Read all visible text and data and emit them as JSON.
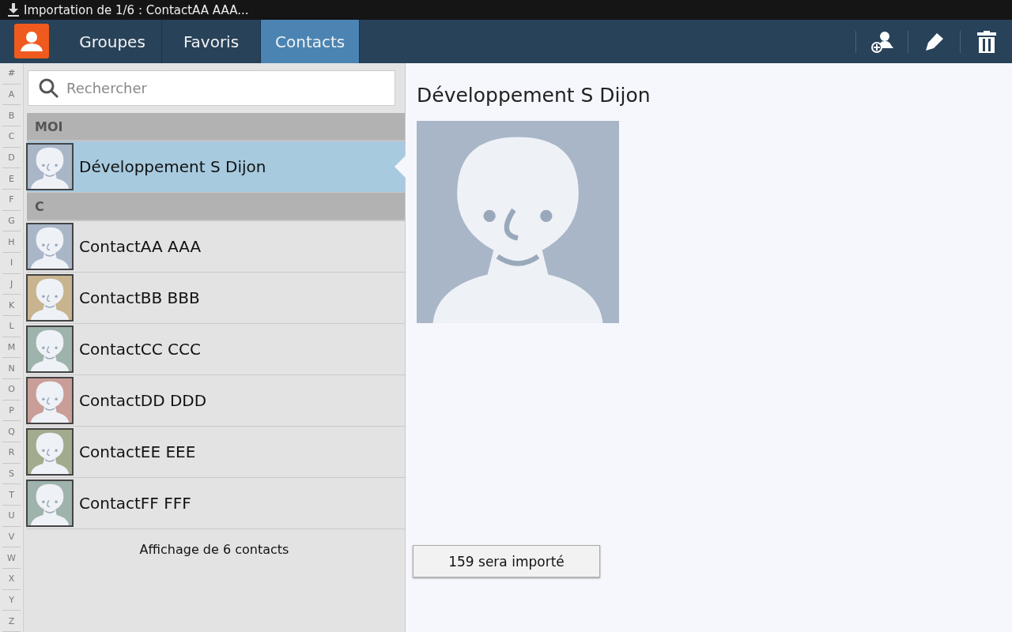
{
  "status_bar": {
    "notification": "Importation de 1/6 : ContactAA AAA..."
  },
  "tabs": [
    {
      "label": "Groupes",
      "selected": false
    },
    {
      "label": "Favoris",
      "selected": false
    },
    {
      "label": "Contacts",
      "selected": true
    }
  ],
  "index": [
    "#",
    "A",
    "B",
    "C",
    "D",
    "E",
    "F",
    "G",
    "H",
    "I",
    "J",
    "K",
    "L",
    "M",
    "N",
    "O",
    "P",
    "Q",
    "R",
    "S",
    "T",
    "U",
    "V",
    "W",
    "X",
    "Y",
    "Z"
  ],
  "search": {
    "placeholder": "Rechercher"
  },
  "sections": [
    {
      "header": "MOI",
      "contacts": [
        {
          "name": "Développement S Dijon",
          "color": "#a9b6c8",
          "selected": true
        }
      ]
    },
    {
      "header": "C",
      "contacts": [
        {
          "name": "ContactAA AAA",
          "color": "#a9b6c8",
          "selected": false
        },
        {
          "name": "ContactBB BBB",
          "color": "#c8b48e",
          "selected": false
        },
        {
          "name": "ContactCC CCC",
          "color": "#9fb3ad",
          "selected": false
        },
        {
          "name": "ContactDD DDD",
          "color": "#c99e98",
          "selected": false
        },
        {
          "name": "ContactEE EEE",
          "color": "#a3ab8e",
          "selected": false
        },
        {
          "name": "ContactFF FFF",
          "color": "#9fb3ad",
          "selected": false
        }
      ]
    }
  ],
  "footer": "Affichage de 6 contacts",
  "detail": {
    "name": "Développement S Dijon",
    "color": "#a9b6c8",
    "import_button": "159 sera importé"
  }
}
